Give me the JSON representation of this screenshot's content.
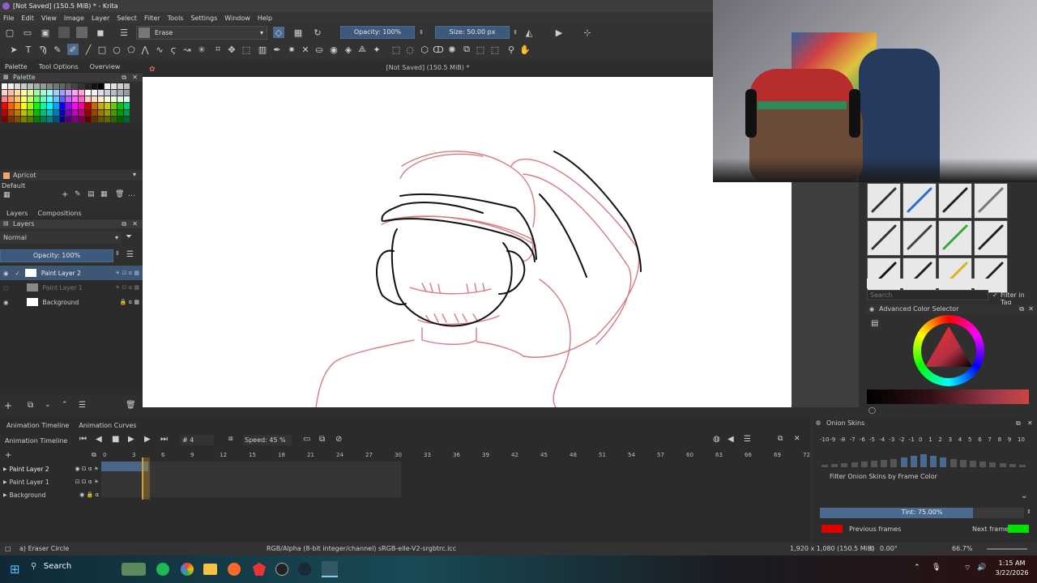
{
  "window": {
    "title": "[Not Saved]  (150.5 MiB) * - Krita"
  },
  "menu": [
    "File",
    "Edit",
    "View",
    "Image",
    "Layer",
    "Select",
    "Filter",
    "Tools",
    "Settings",
    "Window",
    "Help"
  ],
  "toolbar": {
    "brush_preset": "Erase",
    "opacity": "Opacity: 100%",
    "size": "Size: 50.00 px",
    "flow_progress": 1.0
  },
  "docker_tabs": [
    "Palette",
    "Tool Options",
    "Overview"
  ],
  "palette": {
    "title": "Palette",
    "selected_color_name": "Apricot",
    "palette_name": "Default"
  },
  "layers": {
    "tabs": [
      "Layers",
      "Compositions"
    ],
    "title": "Layers",
    "blend_mode": "Normal",
    "opacity": "Opacity:  100%",
    "items": [
      {
        "name": "Paint Layer 2"
      },
      {
        "name": "Paint Layer 1"
      },
      {
        "name": "Background"
      }
    ]
  },
  "canvas": {
    "doc_title": "[Not Saved]  (150.5 MiB) *"
  },
  "timeline": {
    "tabs": [
      "Animation Timeline",
      "Animation Curves"
    ],
    "title": "Animation Timeline",
    "frame": "# 4",
    "speed": "Speed: 45 %",
    "ticks": [
      "0",
      "3",
      "6",
      "9",
      "12",
      "15",
      "18",
      "21",
      "24",
      "27",
      "30",
      "33",
      "36",
      "39",
      "42",
      "45",
      "48",
      "51",
      "54",
      "57",
      "60",
      "63",
      "66",
      "69",
      "72"
    ],
    "layers": [
      "Paint Layer 2",
      "Paint Layer 1",
      "Background"
    ]
  },
  "onion": {
    "title": "Onion Skins",
    "numbers": [
      "-10",
      "-9",
      "-8",
      "-7",
      "-6",
      "-5",
      "-4",
      "-3",
      "-2",
      "-1",
      "0",
      "1",
      "2",
      "3",
      "4",
      "5",
      "6",
      "7",
      "8",
      "9",
      "10"
    ],
    "filter_label": "Filter Onion Skins by Frame Color",
    "tint": "Tint: 75.00%",
    "tint_value": 0.75,
    "previous_label": "Previous frames",
    "next_label": "Next frames",
    "previous_color": "#e00000",
    "next_color": "#00e000"
  },
  "brush_presets": {
    "search_placeholder": "Search",
    "filter_in_tag": "Filter in Tag"
  },
  "color_selector": {
    "title": "Advanced Color Selector"
  },
  "statusbar": {
    "tool": "a) Eraser Circle",
    "color_space": "RGB/Alpha (8-bit integer/channel)  sRGB-elle-V2-srgbtrc.icc",
    "dims": "1,920 x 1,080 (150.5 MiB)",
    "rotation": "0.00°",
    "zoom": "66.7%"
  },
  "taskbar": {
    "search": "Search",
    "time": "1:15 AM",
    "date": "3/22/2026"
  }
}
